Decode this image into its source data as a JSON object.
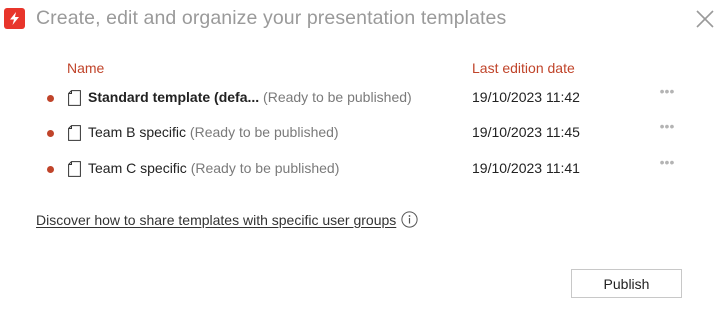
{
  "dialog": {
    "title": "Create, edit and organize your presentation templates",
    "close_icon": "close-icon",
    "logo_icon": "app-logo-icon",
    "accent_color": "#c0442a",
    "brand_color": "#e8352b"
  },
  "table": {
    "headers": {
      "name": "Name",
      "date": "Last edition date"
    },
    "rows": [
      {
        "name": "Standard template (defa...",
        "bold": true,
        "status": " (Ready to be published)",
        "date": "19/10/2023 11:42",
        "more": "•••"
      },
      {
        "name": "Team B specific",
        "bold": false,
        "status": " (Ready to be published)",
        "date": "19/10/2023 11:45",
        "more": "•••"
      },
      {
        "name": "Team C specific",
        "bold": false,
        "status": " (Ready to be published)",
        "date": "19/10/2023 11:41",
        "more": "•••"
      }
    ]
  },
  "help": {
    "link_text": "Discover how to share templates with specific user groups",
    "info_icon": "info-icon"
  },
  "footer": {
    "publish_label": "Publish"
  }
}
